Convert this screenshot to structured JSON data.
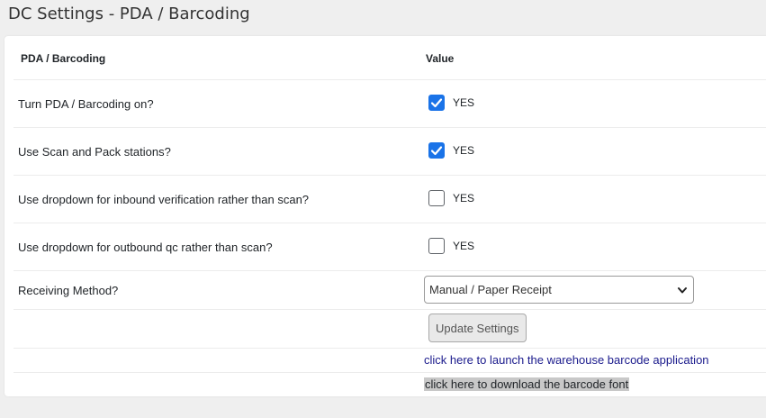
{
  "page": {
    "title": "DC Settings - PDA / Barcoding"
  },
  "table": {
    "header": {
      "setting": "PDA / Barcoding",
      "value": "Value"
    },
    "rows": [
      {
        "label": "Turn PDA / Barcoding on?",
        "checked": true,
        "value_label": "YES"
      },
      {
        "label": "Use Scan and Pack stations?",
        "checked": true,
        "value_label": "YES"
      },
      {
        "label": "Use dropdown for inbound verification rather than scan?",
        "checked": false,
        "value_label": "YES"
      },
      {
        "label": "Use dropdown for outbound qc rather than scan?",
        "checked": false,
        "value_label": "YES"
      }
    ],
    "receiving": {
      "label": "Receiving Method?",
      "selected": "Manual / Paper Receipt"
    },
    "actions": {
      "update_label": "Update Settings",
      "launch_link": "click here to launch the warehouse barcode application",
      "download_link": "click here to download the barcode font"
    }
  },
  "colors": {
    "accent": "#1a73e8",
    "link": "#1a1a8c"
  }
}
